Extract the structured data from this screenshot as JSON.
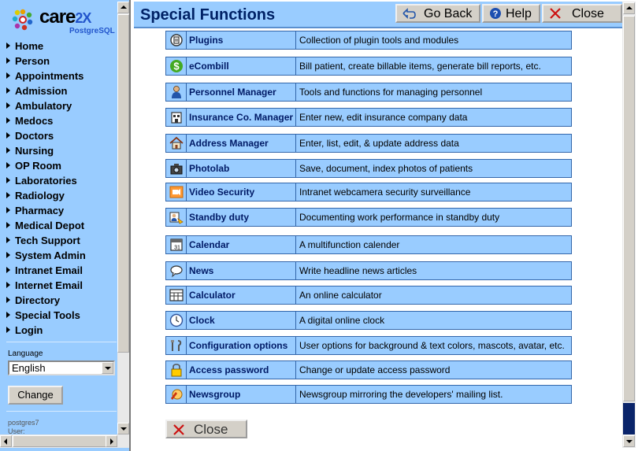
{
  "brand": {
    "name": "care",
    "name_suffix": "2X",
    "subtitle": "PostgreSQL"
  },
  "nav": {
    "items": [
      "Home",
      "Person",
      "Appointments",
      "Admission",
      "Ambulatory",
      "Medocs",
      "Doctors",
      "Nursing",
      "OP Room",
      "Laboratories",
      "Radiology",
      "Pharmacy",
      "Medical Depot",
      "Tech Support",
      "System Admin",
      "Intranet Email",
      "Internet Email",
      "Directory",
      "Special Tools",
      "Login"
    ],
    "language_label": "Language",
    "language_value": "English",
    "change_label": "Change",
    "user_lines": [
      "postgres7",
      "User:"
    ]
  },
  "header": {
    "title": "Special Functions",
    "go_back": "Go Back",
    "help": "Help",
    "close": "Close"
  },
  "functions": [
    {
      "name": "Plugins",
      "desc": "Collection of plugin tools and modules",
      "icon": "plugin-icon"
    },
    {
      "name": "eCombill",
      "desc": "Bill patient, create billable items, generate bill reports, etc.",
      "icon": "dollar-icon"
    },
    {
      "name": "Personnel Manager",
      "desc": "Tools and functions for managing personnel",
      "icon": "person-icon"
    },
    {
      "name": "Insurance Co. Manager",
      "desc": "Enter new, edit insurance company data",
      "icon": "insurance-icon"
    },
    {
      "name": "Address Manager",
      "desc": "Enter, list, edit, & update address data",
      "icon": "house-icon"
    },
    {
      "name": "Photolab",
      "desc": "Save, document, index photos of patients",
      "icon": "camera-icon"
    },
    {
      "name": "Video Security",
      "desc": "Intranet webcamera security surveillance",
      "icon": "video-icon"
    },
    {
      "name": "Standby duty",
      "desc": "Documenting work performance in standby duty",
      "icon": "standby-icon"
    },
    {
      "name": "Calendar",
      "desc": "A multifunction calender",
      "icon": "calendar-icon"
    },
    {
      "name": "News",
      "desc": "Write headline news articles",
      "icon": "speech-bubble-icon"
    },
    {
      "name": "Calculator",
      "desc": "An online calculator",
      "icon": "calculator-icon"
    },
    {
      "name": "Clock",
      "desc": "A digital online clock",
      "icon": "clock-icon"
    },
    {
      "name": "Configuration options",
      "desc": "User options for background & text colors, mascots, avatar, etc.",
      "icon": "tools-icon"
    },
    {
      "name": "Access password",
      "desc": "Change or update access password",
      "icon": "lock-icon"
    },
    {
      "name": "Newsgroup",
      "desc": "Newsgroup mirroring the developers' mailing list.",
      "icon": "newsgroup-icon"
    }
  ],
  "footer": {
    "close": "Close"
  },
  "colors": {
    "panel": "#99ccff",
    "border": "#3366aa",
    "title": "#002266"
  }
}
